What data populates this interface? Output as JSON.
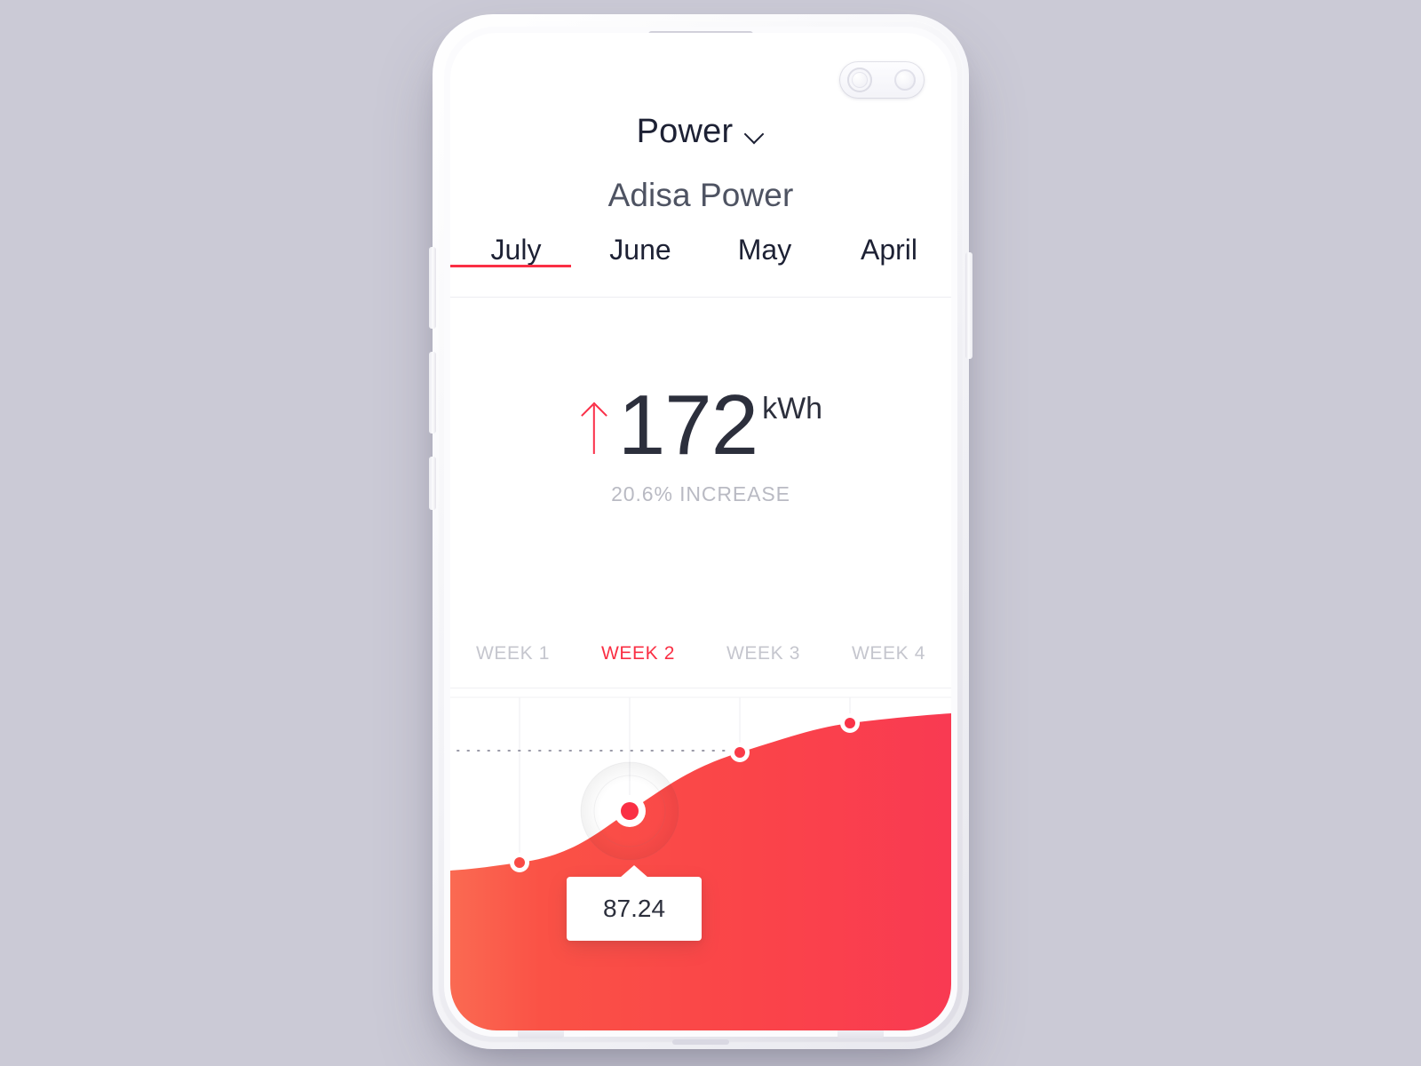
{
  "app": {
    "title": "Power",
    "title_icon": "chevron-down-icon",
    "subtitle": "Adisa Power"
  },
  "month_tabs": [
    {
      "label": "July",
      "active": true
    },
    {
      "label": "June",
      "active": false
    },
    {
      "label": "May",
      "active": false
    },
    {
      "label": "April",
      "active": false
    }
  ],
  "metric": {
    "trend_icon": "arrow-up-icon",
    "value": "172",
    "unit": "kWh",
    "change": "20.6% INCREASE"
  },
  "week_tabs": [
    {
      "label": "WEEK 1",
      "active": false
    },
    {
      "label": "WEEK 2",
      "active": true
    },
    {
      "label": "WEEK 3",
      "active": false
    },
    {
      "label": "WEEK 4",
      "active": false
    }
  ],
  "tooltip": {
    "value": "87.24"
  },
  "colors": {
    "accent": "#FA2F44",
    "area_start": "#FA5246",
    "area_end": "#F93A52",
    "title": "#1D2134",
    "subtitle": "#4E5362",
    "muted": "#C5C6CE",
    "background": "#CBCAD6"
  },
  "chart_data": {
    "type": "area",
    "title": "",
    "xlabel": "",
    "ylabel": "",
    "grid": true,
    "legend": false,
    "categories": [
      "WEEK 1",
      "WEEK 2",
      "WEEK 3",
      "WEEK 4"
    ],
    "x": [
      1,
      2,
      3,
      4
    ],
    "values": [
      62.5,
      87.24,
      110.0,
      134.0
    ],
    "highlighted_index": 1,
    "highlighted_value": "87.24",
    "reference_line": {
      "style": "dotted",
      "value": 122.0
    },
    "gridlines_x": [
      1,
      2,
      3,
      4
    ],
    "ylim": [
      0,
      160
    ]
  }
}
